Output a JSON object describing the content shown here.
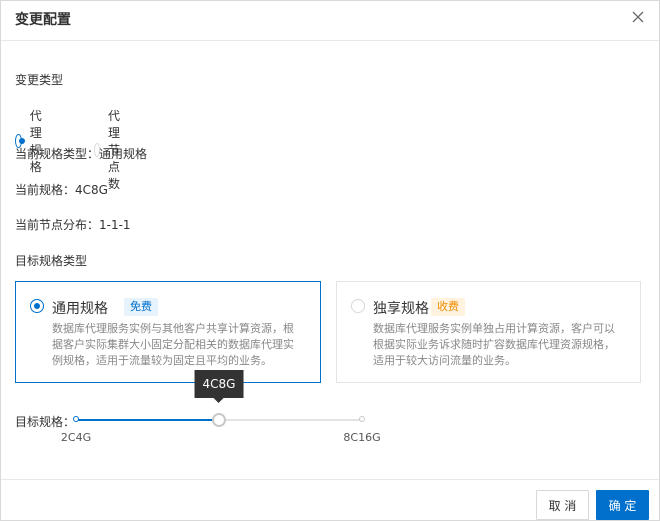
{
  "dialog": {
    "title": "变更配置"
  },
  "change_type": {
    "label": "变更类型",
    "options": [
      {
        "label": "代理规格",
        "checked": true
      },
      {
        "label": "代理节点数",
        "checked": false
      }
    ]
  },
  "current": {
    "spec_type": "当前规格类型：通用规格",
    "spec": "当前规格：4C8G",
    "node_distribution": "当前节点分布：1-1-1"
  },
  "target_type": {
    "label": "目标规格类型",
    "cards": [
      {
        "title": "通用规格",
        "badge": "免费",
        "selected": true,
        "description": "数据库代理服务实例与其他客户共享计算资源，根据客户实际集群大小固定分配相关的数据库代理实例规格，适用于流量较为固定且平均的业务。"
      },
      {
        "title": "独享规格",
        "badge": "收费",
        "selected": false,
        "description": "数据库代理服务实例单独占用计算资源，客户可以根据实际业务诉求随时扩容数据库代理资源规格，适用于较大访问流量的业务。"
      }
    ]
  },
  "target_spec": {
    "label": "目标规格：",
    "options": [
      "2C4G",
      "4C8G",
      "8C16G"
    ],
    "selected": "4C8G",
    "selected_index": 1,
    "tick_labels": [
      "2C4G",
      "8C16G"
    ]
  },
  "colors": {
    "primary": "#0070cc",
    "free_badge_bg": "#e6f2fc",
    "paid_badge_text": "#f08c00"
  },
  "footer": {
    "cancel_label": "取 消",
    "ok_label": "确 定"
  }
}
